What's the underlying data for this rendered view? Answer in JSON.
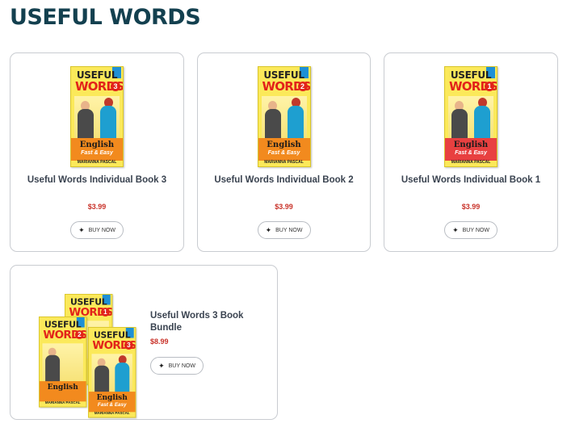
{
  "page": {
    "title": "USEFUL WORDS"
  },
  "book_cover": {
    "useful": "USEFUL",
    "words": "WORDS",
    "english": "English",
    "fast_easy": "Fast & Easy",
    "author": "MARIANNA PASCAL"
  },
  "products": [
    {
      "name": "Useful Words Individual Book 3",
      "price": "$3.99",
      "button": "BUY NOW",
      "volume": "3"
    },
    {
      "name": "Useful Words Individual Book 2",
      "price": "$3.99",
      "button": "BUY NOW",
      "volume": "2"
    },
    {
      "name": "Useful Words Individual Book 1",
      "price": "$3.99",
      "button": "BUY NOW",
      "volume": "1"
    },
    {
      "name": "Useful Words 3 Book Bundle",
      "price": "$8.99",
      "button": "BUY NOW",
      "volumes": [
        "1",
        "2",
        "3"
      ]
    }
  ],
  "colors": {
    "title": "#13404f",
    "price": "#c9332a",
    "accent_red": "#e2231a",
    "cover_yellow": "#fbe95a"
  },
  "icons": {
    "buy": "sparkle-icon"
  }
}
